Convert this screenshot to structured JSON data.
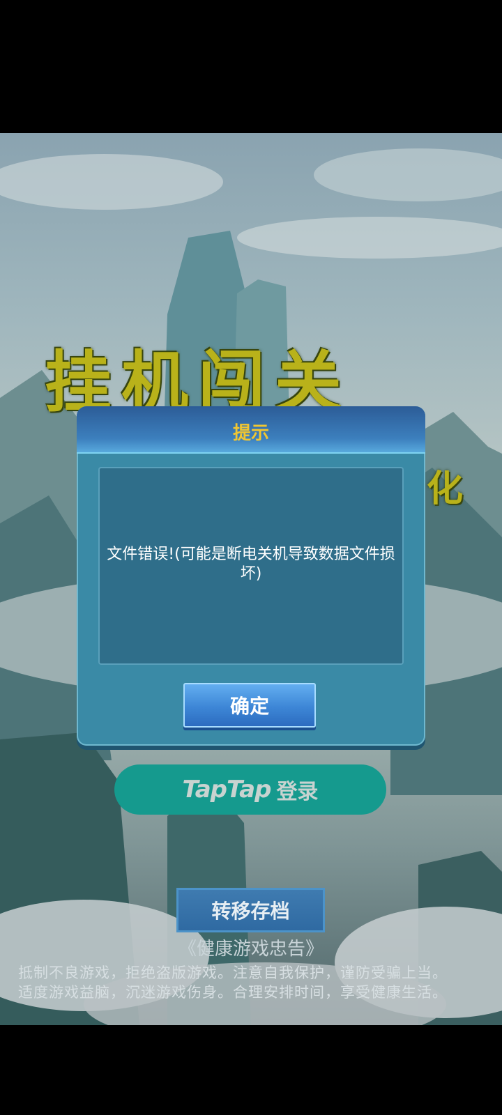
{
  "game": {
    "title": "挂机闯关",
    "title_suffix": "化"
  },
  "dialog": {
    "title": "提示",
    "message": "文件错误!(可能是断电关机导致数据文件损坏)",
    "confirm_label": "确定"
  },
  "login": {
    "brand": "TapTap",
    "suffix": "登录"
  },
  "transfer": {
    "label": "转移存档"
  },
  "health_notice": {
    "title": "《健康游戏忠告》",
    "line1": "抵制不良游戏，拒绝盗版游戏。注意自我保护，谨防受骗上当。",
    "line2": "适度游戏益脑，沉迷游戏伤身。合理安排时间，享受健康生活。"
  },
  "colors": {
    "dialog_bg": "#3a8aa6",
    "dialog_title": "#f1c631",
    "taptap_green": "#159a8e",
    "button_blue": "#3d86d6"
  }
}
